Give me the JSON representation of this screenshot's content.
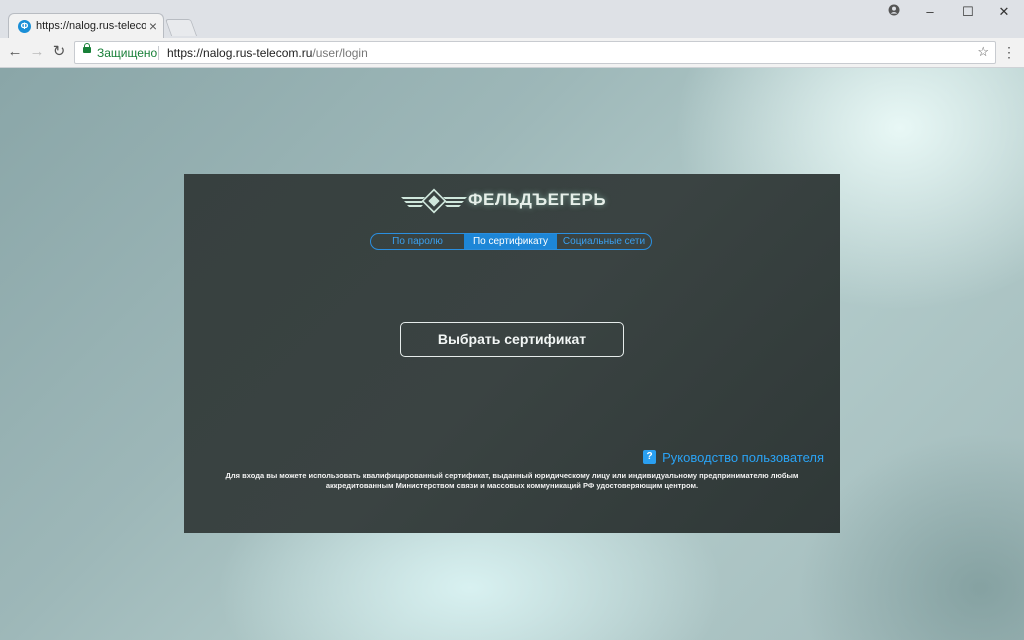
{
  "browser": {
    "tab_title": "https://nalog.rus-telecom",
    "tab_favicon": "Ф",
    "tab_close": "×",
    "profile_icon": "person-icon",
    "minimize": "–",
    "maximize": "☐",
    "close": "✕",
    "back": "←",
    "forward": "→",
    "reload": "↻",
    "secure_label": "Защищено",
    "url_host": "https://nalog.rus-telecom.ru",
    "url_path": "/user/login",
    "star": "☆",
    "menu": "⋮"
  },
  "login": {
    "brand": "ФЕЛЬДЪЕГЕРЬ",
    "tabs": [
      {
        "label": "По паролю",
        "active": false
      },
      {
        "label": "По сертификату",
        "active": true
      },
      {
        "label": "Социальные сети",
        "active": false
      }
    ],
    "select_cert_button": "Выбрать сертификат",
    "guide_icon": "?",
    "guide_link": "Руководство пользователя",
    "note_line1": "Для входа вы можете использовать квалифицированный сертификат, выданный юридическому лицу или индивидуальному предпринимателю любым",
    "note_line2": "аккредитованным Министерством связи и массовых коммуникаций РФ удостоверяющим центром."
  },
  "colors": {
    "accent": "#1d86d7",
    "card_bg": "#37403f",
    "secure_green": "#188038"
  }
}
